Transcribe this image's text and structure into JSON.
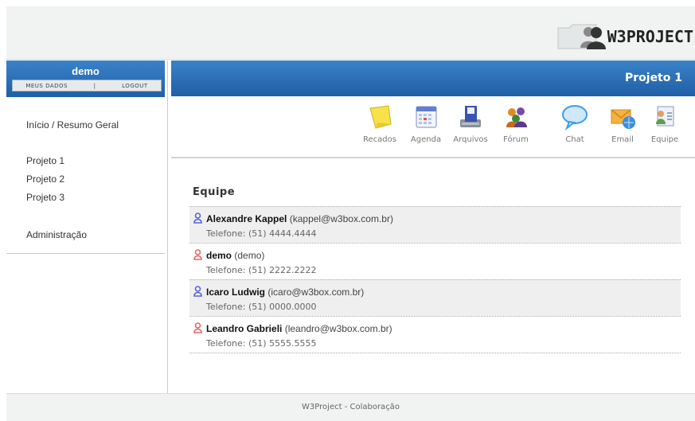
{
  "header": {
    "logo_text": "W3PROJECT"
  },
  "user": {
    "name": "demo",
    "links": {
      "my_data": "MEUS DADOS",
      "separator": "|",
      "logout": "LOGOUT"
    }
  },
  "nav": {
    "overview": "Início / Resumo Geral",
    "projects": [
      "Projeto 1",
      "Projeto 2",
      "Projeto 3"
    ],
    "admin": "Administração"
  },
  "main": {
    "project_title": "Projeto 1"
  },
  "toolbar": [
    {
      "label": "Recados",
      "icon": "note-icon"
    },
    {
      "label": "Agenda",
      "icon": "calendar-icon"
    },
    {
      "label": "Arquivos",
      "icon": "files-icon"
    },
    {
      "label": "Fórum",
      "icon": "forum-icon"
    },
    {
      "label": "Chat",
      "icon": "chat-bubble-icon"
    },
    {
      "label": "Email",
      "icon": "email-icon"
    },
    {
      "label": "Equipe",
      "icon": "team-icon"
    }
  ],
  "team": {
    "title": "Equipe",
    "members": [
      {
        "name": "Alexandre Kappel",
        "email": "(kappel@w3box.com.br)",
        "phone": "Telefone: (51) 4444.4444",
        "icon_color": "#5566dd"
      },
      {
        "name": "demo",
        "email": "(demo)",
        "phone": "Telefone: (51) 2222.2222",
        "icon_color": "#e06a6a"
      },
      {
        "name": "Icaro Ludwig",
        "email": "(icaro@w3box.com.br)",
        "phone": "Telefone: (51) 0000.0000",
        "icon_color": "#5566dd"
      },
      {
        "name": "Leandro Gabrieli",
        "email": "(leandro@w3box.com.br)",
        "phone": "Telefone: (51) 5555.5555",
        "icon_color": "#e06a6a"
      }
    ]
  },
  "footer": {
    "text": "W3Project - Colaboração"
  },
  "colors": {
    "header_blue": "#2a6fb9",
    "accent_gray": "#f1f3f3"
  }
}
